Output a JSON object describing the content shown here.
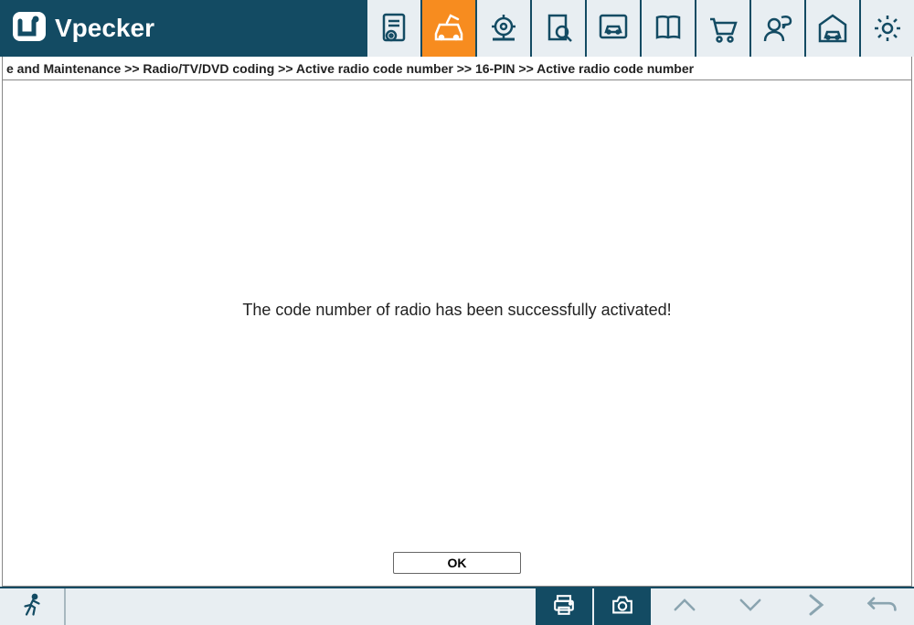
{
  "header": {
    "app_name": "Vpecker"
  },
  "toolbar": {
    "items": [
      {
        "icon": "document-gear",
        "active": false
      },
      {
        "icon": "car-diag",
        "active": true
      },
      {
        "icon": "engine-wrench",
        "active": false
      },
      {
        "icon": "book-search",
        "active": false
      },
      {
        "icon": "screen-car",
        "active": false
      },
      {
        "icon": "manual-book",
        "active": false
      },
      {
        "icon": "shopping-cart",
        "active": false
      },
      {
        "icon": "person-chat",
        "active": false
      },
      {
        "icon": "garage",
        "active": false
      },
      {
        "icon": "gear",
        "active": false
      }
    ]
  },
  "breadcrumb": {
    "text": "e and Maintenance >> Radio/TV/DVD coding >> Active radio code number >> 16-PIN >> Active radio code number"
  },
  "main": {
    "message": "The code number of radio has been successfully activated!",
    "ok_label": "OK"
  },
  "footer": {
    "exit": "exit",
    "print": "print",
    "screenshot": "screenshot",
    "up": "up",
    "down": "down",
    "confirm": "confirm",
    "back": "back"
  }
}
